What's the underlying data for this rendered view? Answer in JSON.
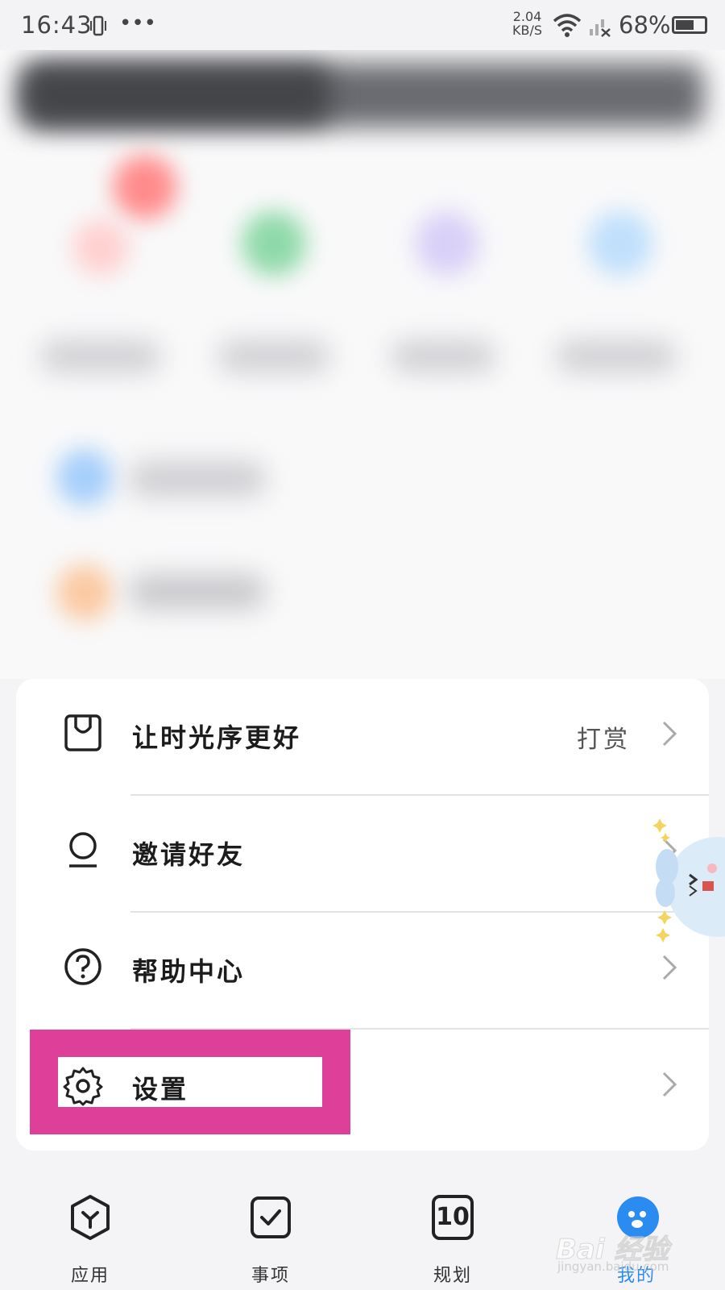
{
  "status_bar": {
    "time": "16:43",
    "more": "•••",
    "speed_value": "2.04",
    "speed_unit": "KB/S",
    "battery_percent": "68%",
    "battery_level": 0.68
  },
  "menu": {
    "items": [
      {
        "label": "让时光序更好",
        "extra": "打赏",
        "icon": "envelope-icon"
      },
      {
        "label": "邀请好友",
        "extra": "",
        "icon": "person-icon"
      },
      {
        "label": "帮助中心",
        "extra": "",
        "icon": "help-icon"
      },
      {
        "label": "设置",
        "extra": "",
        "icon": "gear-icon"
      }
    ]
  },
  "tabbar": {
    "tabs": [
      {
        "label": "应用",
        "icon": "apps-icon",
        "active": false
      },
      {
        "label": "事项",
        "icon": "checklist-icon",
        "active": false
      },
      {
        "label": "规划",
        "icon": "calendar-icon",
        "badge": "10",
        "active": false
      },
      {
        "label": "我的",
        "icon": "profile-icon",
        "active": true
      }
    ]
  },
  "watermark": {
    "text": "Bai 经验",
    "sub": "jingyan.baidu.com"
  },
  "colors": {
    "accent": "#2a8cf0",
    "highlight": "#de3f99"
  }
}
